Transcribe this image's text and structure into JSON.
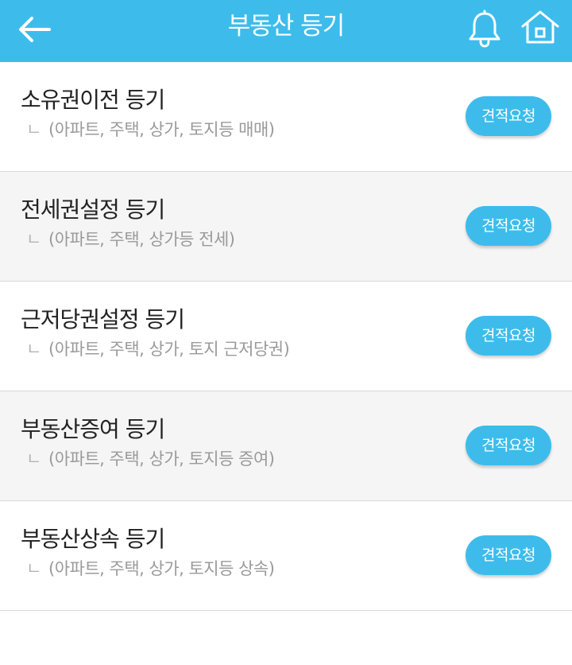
{
  "header": {
    "title": "부동산 등기",
    "back_icon": "arrow-left-icon",
    "bell_icon": "bell-icon",
    "home_icon": "home-icon",
    "bg_color": "#3dbcec"
  },
  "items": [
    {
      "title": "소유권이전 등기",
      "subtitle_mark": "ㄴ",
      "subtitle": "(아파트, 주택, 상가, 토지등 매매)",
      "button": "견적요청"
    },
    {
      "title": "전세권설정 등기",
      "subtitle_mark": "ㄴ",
      "subtitle": "(아파트, 주택, 상가등 전세)",
      "button": "견적요청"
    },
    {
      "title": "근저당권설정 등기",
      "subtitle_mark": "ㄴ",
      "subtitle": "(아파트, 주택, 상가, 토지 근저당권)",
      "button": "견적요청"
    },
    {
      "title": "부동산증여 등기",
      "subtitle_mark": "ㄴ",
      "subtitle": "(아파트, 주택, 상가, 토지등 증여)",
      "button": "견적요청"
    },
    {
      "title": "부동산상속 등기",
      "subtitle_mark": "ㄴ",
      "subtitle": "(아파트, 주택, 상가, 토지등 상속)",
      "button": "견적요청"
    }
  ],
  "colors": {
    "accent": "#3dbcec",
    "alt_row": "#f5f5f5",
    "divider": "#d9d9d9"
  }
}
